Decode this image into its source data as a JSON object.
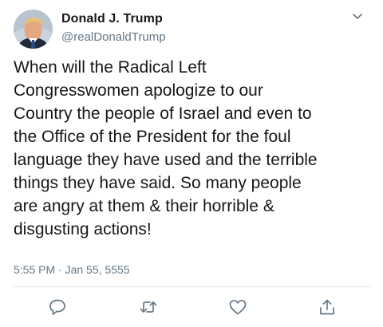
{
  "tweet": {
    "author_name": "Donald J. Trump",
    "author_handle": "@realDonaldTrump",
    "text": "When will the Radical Left\nCongresswomen apologize to our\nCountry the people of Israel and even to\nthe Office of the President for the foul\nlanguage they have used and the terrible\nthings they have said. So many people\nare angry at them & their horrible &\ndisgusting actions!",
    "timestamp": "5:55 PM · Jan 55, 5555"
  },
  "colors": {
    "text_primary": "#14171a",
    "text_secondary": "#657786",
    "divider": "#e1e8ed",
    "icon": "#657786"
  },
  "icons": {
    "more": "chevron-down-icon",
    "reply": "reply-icon",
    "retweet": "retweet-icon",
    "like": "heart-icon",
    "share": "share-icon"
  }
}
